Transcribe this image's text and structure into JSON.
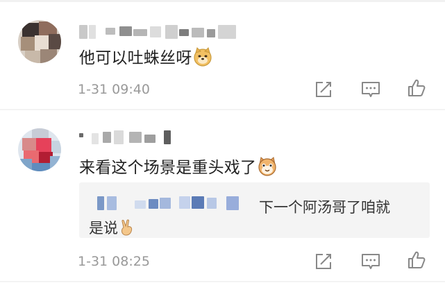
{
  "comments": [
    {
      "text": "他可以吐蛛丝呀",
      "emoji": "doge-face",
      "time": "1-31 09:40",
      "actions": [
        "share-icon",
        "comment-icon",
        "like-icon"
      ]
    },
    {
      "text": "来看这个场景是重头戏了",
      "emoji": "cat-face",
      "time": "1-31 08:25",
      "reply": {
        "text_line1": "下一个阿汤哥了咱就",
        "text_line2": "是说",
        "emoji": "victory-hand"
      },
      "actions": [
        "share-icon",
        "comment-icon",
        "like-icon"
      ]
    }
  ],
  "colors": {
    "text": "#222222",
    "meta": "#999999",
    "reply_bg": "#f4f4f4",
    "icon": "#888888"
  }
}
